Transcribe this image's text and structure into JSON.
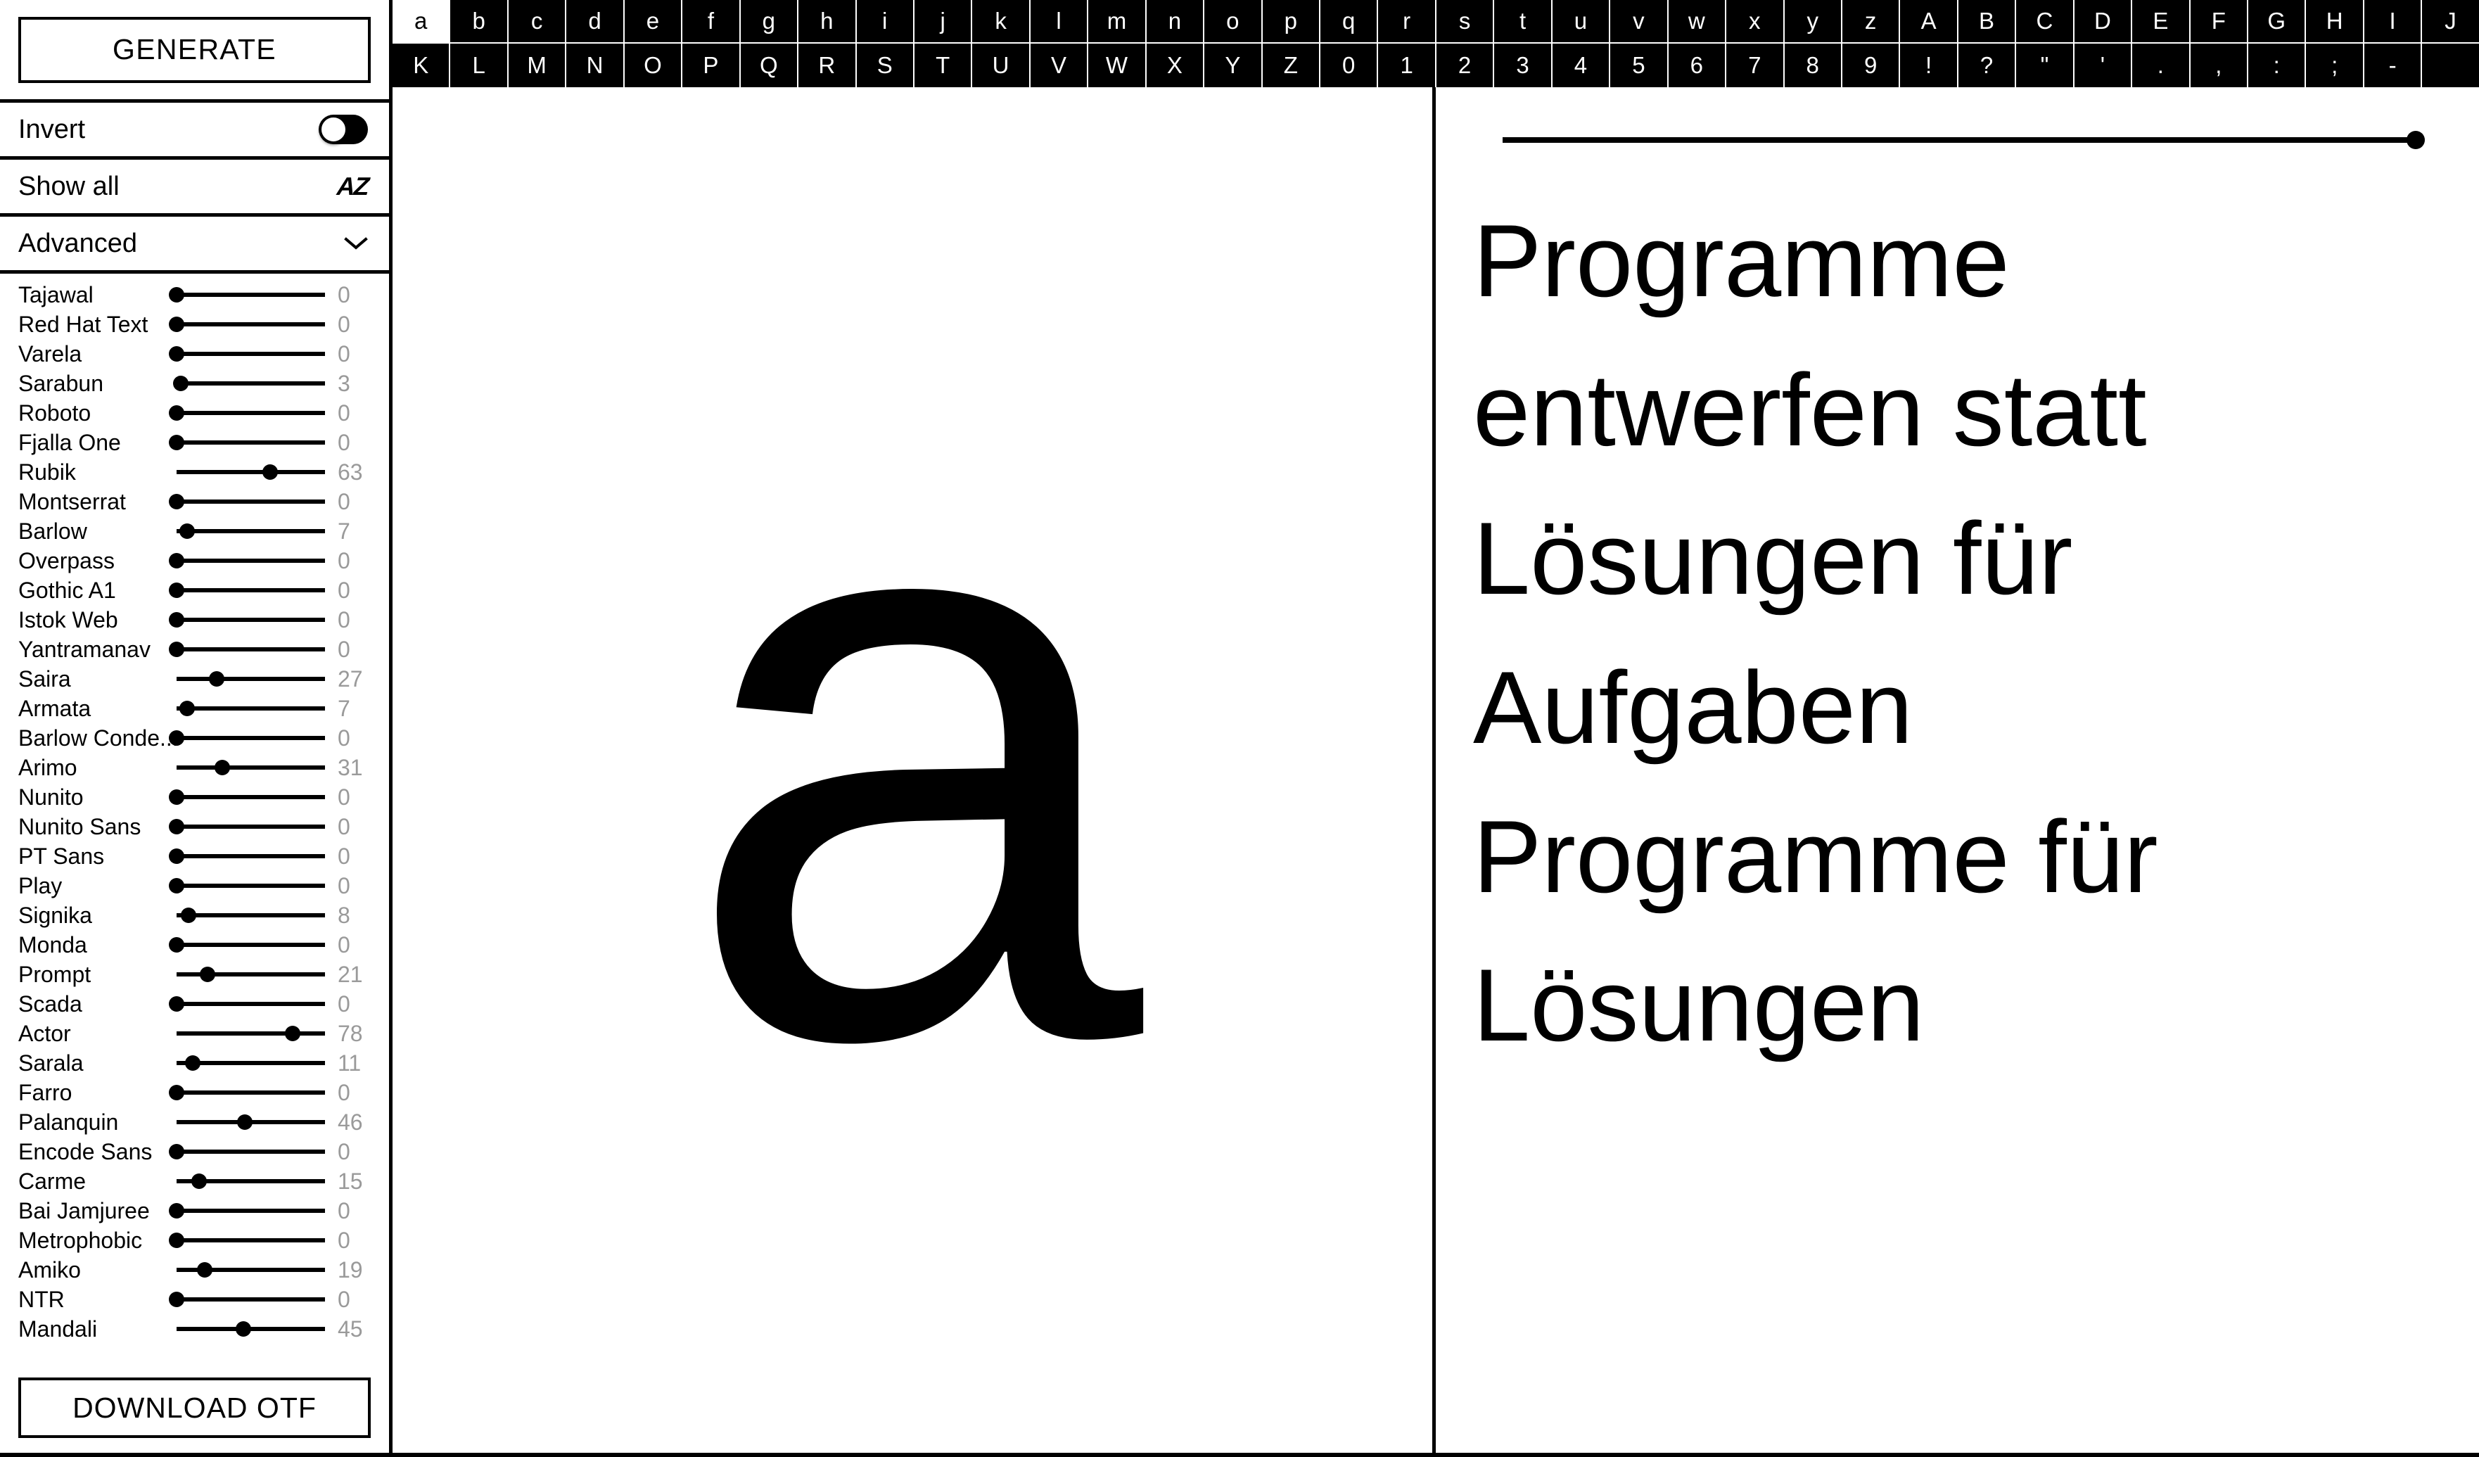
{
  "sidebar": {
    "generate_label": "GENERATE",
    "download_label": "DOWNLOAD OTF",
    "options": [
      {
        "label": "Invert",
        "control": "toggle",
        "state": "off"
      },
      {
        "label": "Show all",
        "control": "az-icon",
        "icon_text": "AZ"
      },
      {
        "label": "Advanced",
        "control": "chevron",
        "state": "collapsed"
      }
    ],
    "fonts": [
      {
        "name": "Tajawal",
        "value": 0
      },
      {
        "name": "Red Hat Text",
        "value": 0
      },
      {
        "name": "Varela",
        "value": 0
      },
      {
        "name": "Sarabun",
        "value": 3
      },
      {
        "name": "Roboto",
        "value": 0
      },
      {
        "name": "Fjalla One",
        "value": 0
      },
      {
        "name": "Rubik",
        "value": 63
      },
      {
        "name": "Montserrat",
        "value": 0
      },
      {
        "name": "Barlow",
        "value": 7
      },
      {
        "name": "Overpass",
        "value": 0
      },
      {
        "name": "Gothic A1",
        "value": 0
      },
      {
        "name": "Istok Web",
        "value": 0
      },
      {
        "name": "Yantramanav",
        "value": 0
      },
      {
        "name": "Saira",
        "value": 27
      },
      {
        "name": "Armata",
        "value": 7
      },
      {
        "name": "Barlow Conde...",
        "value": 0
      },
      {
        "name": "Arimo",
        "value": 31
      },
      {
        "name": "Nunito",
        "value": 0
      },
      {
        "name": "Nunito Sans",
        "value": 0
      },
      {
        "name": "PT Sans",
        "value": 0
      },
      {
        "name": "Play",
        "value": 0
      },
      {
        "name": "Signika",
        "value": 8
      },
      {
        "name": "Monda",
        "value": 0
      },
      {
        "name": "Prompt",
        "value": 21
      },
      {
        "name": "Scada",
        "value": 0
      },
      {
        "name": "Actor",
        "value": 78
      },
      {
        "name": "Sarala",
        "value": 11
      },
      {
        "name": "Farro",
        "value": 0
      },
      {
        "name": "Palanquin",
        "value": 46
      },
      {
        "name": "Encode Sans",
        "value": 0
      },
      {
        "name": "Carme",
        "value": 15
      },
      {
        "name": "Bai Jamjuree",
        "value": 0
      },
      {
        "name": "Metrophobic",
        "value": 0
      },
      {
        "name": "Amiko",
        "value": 19
      },
      {
        "name": "NTR",
        "value": 0
      },
      {
        "name": "Mandali",
        "value": 45
      }
    ],
    "slider_min": 0,
    "slider_max": 100
  },
  "char_strip": {
    "selected": "a",
    "row1": [
      "a",
      "b",
      "c",
      "d",
      "e",
      "f",
      "g",
      "h",
      "i",
      "j",
      "k",
      "l",
      "m",
      "n",
      "o",
      "p",
      "q",
      "r",
      "s",
      "t",
      "u",
      "v",
      "w",
      "x",
      "y",
      "z",
      "A",
      "B",
      "C",
      "D",
      "E",
      "F",
      "G",
      "H",
      "I",
      "J"
    ],
    "row2": [
      "K",
      "L",
      "M",
      "N",
      "O",
      "P",
      "Q",
      "R",
      "S",
      "T",
      "U",
      "V",
      "W",
      "X",
      "Y",
      "Z",
      "0",
      "1",
      "2",
      "3",
      "4",
      "5",
      "6",
      "7",
      "8",
      "9",
      "!",
      "?",
      "\"",
      "'",
      ".",
      ",",
      ":",
      ";",
      "-",
      " "
    ]
  },
  "glyph_preview": {
    "character": "a"
  },
  "text_panel": {
    "size_slider": {
      "value": 100,
      "min": 0,
      "max": 100
    },
    "preview_text": "Programme entwerfen statt Lösungen für Aufgaben Programme für Lösungen"
  },
  "colors": {
    "foreground": "#000000",
    "background": "#ffffff",
    "value_text": "#9a9a9a",
    "strip_background": "#000000",
    "strip_text": "#ffffff"
  }
}
